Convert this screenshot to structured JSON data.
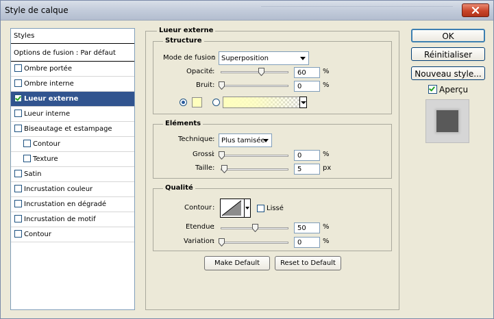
{
  "window": {
    "title": "Style de calque"
  },
  "styles_list": {
    "header": "Styles",
    "blending": "Options de fusion : Par défaut",
    "items": [
      {
        "label": "Ombre portée",
        "checked": false
      },
      {
        "label": "Ombre interne",
        "checked": false
      },
      {
        "label": "Lueur externe",
        "checked": true,
        "selected": true
      },
      {
        "label": "Lueur interne",
        "checked": false
      },
      {
        "label": "Biseautage et estampage",
        "checked": false
      },
      {
        "label": "Contour",
        "checked": false,
        "indent": true
      },
      {
        "label": "Texture",
        "checked": false,
        "indent": true
      },
      {
        "label": "Satin",
        "checked": false
      },
      {
        "label": "Incrustation couleur",
        "checked": false
      },
      {
        "label": "Incrustation en dégradé",
        "checked": false
      },
      {
        "label": "Incrustation de motif",
        "checked": false
      },
      {
        "label": "Contour",
        "checked": false
      }
    ]
  },
  "panel": {
    "title": "Lueur externe",
    "structure": {
      "title": "Structure",
      "blend_mode_label": "Mode de fusion",
      "blend_mode_value": "Superposition",
      "opacity_label": "Opacité",
      "opacity_value": "60",
      "opacity_unit": "%",
      "noise_label": "Bruit",
      "noise_value": "0",
      "noise_unit": "%",
      "color_swatch": "#ffffbe"
    },
    "elements": {
      "title": "Eléments",
      "technique_label": "Technique",
      "technique_value": "Plus tamisée",
      "spread_label": "Grossi",
      "spread_value": "0",
      "spread_unit": "%",
      "size_label": "Taille",
      "size_value": "5",
      "size_unit": "px"
    },
    "quality": {
      "title": "Qualité",
      "contour_label": "Contour",
      "antialias_label": "Lissé",
      "antialias_checked": false,
      "range_label": "Etendue",
      "range_value": "50",
      "range_unit": "%",
      "jitter_label": "Variation",
      "jitter_value": "0",
      "jitter_unit": "%"
    },
    "make_default": "Make Default",
    "reset_default": "Reset to Default"
  },
  "buttons": {
    "ok": "OK",
    "reset": "Réinitialiser",
    "new_style": "Nouveau style..."
  },
  "preview": {
    "label": "Aperçu",
    "checked": true
  },
  "colors": {
    "selection": "#31548f",
    "swatch": "#ffffbe",
    "preview_square": "#595959"
  }
}
